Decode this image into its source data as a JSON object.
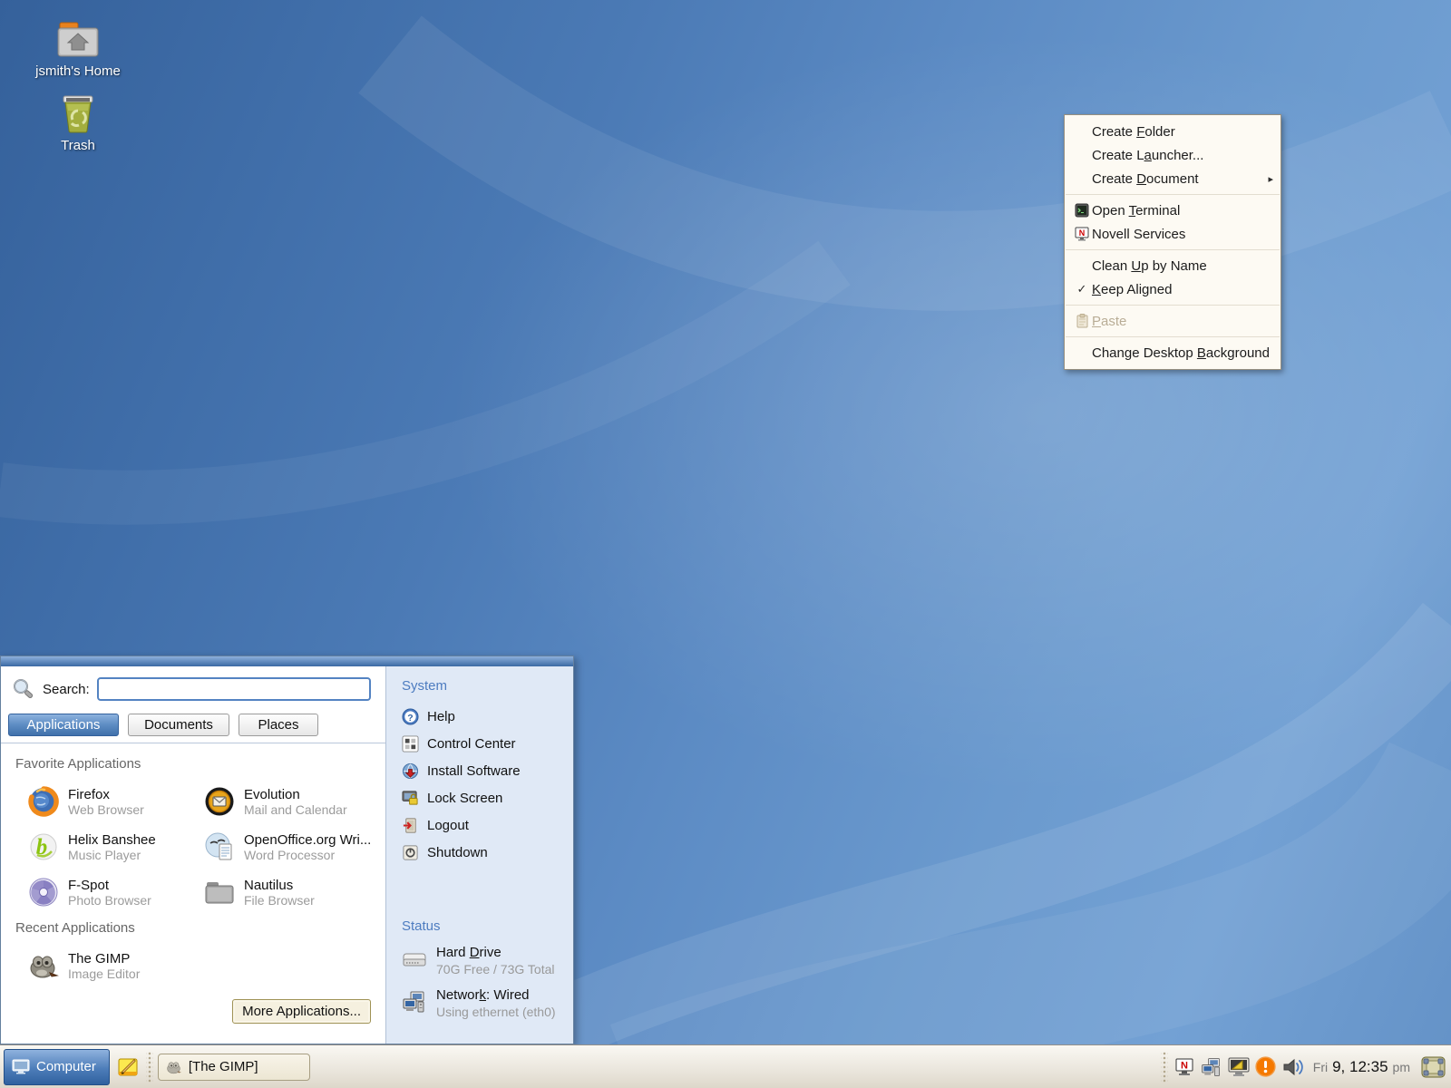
{
  "colors": {
    "accent_blue": "#4071ab",
    "menu_cream": "#fdfaf3",
    "panel_blue": "#e0e9f6",
    "taskbar_tan": "#e7e2d8",
    "selection_blue": "#5383c2",
    "update_orange": "#f57900"
  },
  "desktop": {
    "icons": [
      {
        "label": "jsmith's Home",
        "icon": "home-folder-icon"
      },
      {
        "label": "Trash",
        "icon": "trash-icon"
      }
    ]
  },
  "context_menu": {
    "items": [
      {
        "pre": "Create ",
        "key": "F",
        "post": "older"
      },
      {
        "pre": "Create L",
        "key": "a",
        "post": "uncher..."
      },
      {
        "pre": "Create ",
        "key": "D",
        "post": "ocument",
        "submenu": true
      },
      {
        "pre": "Open ",
        "key": "T",
        "post": "erminal",
        "icon": "terminal-icon"
      },
      {
        "pre": "Novell Services",
        "key": "",
        "post": "",
        "icon": "novell-icon"
      },
      {
        "pre": "Clean ",
        "key": "U",
        "post": "p by Name"
      },
      {
        "pre": "",
        "key": "K",
        "post": "eep Aligned",
        "checked": true
      },
      {
        "pre": "",
        "key": "P",
        "post": "aste",
        "icon": "paste-icon",
        "disabled": true
      },
      {
        "pre": "Change Desktop ",
        "key": "B",
        "post": "ackground"
      }
    ]
  },
  "menu": {
    "search": {
      "label": "Search:",
      "value": ""
    },
    "tabs": [
      {
        "label": "Applications",
        "active": true
      },
      {
        "label": "Documents",
        "active": false
      },
      {
        "label": "Places",
        "active": false
      }
    ],
    "favorites_header": "Favorite Applications",
    "recent_header": "Recent Applications",
    "favorites": [
      {
        "name": "Firefox",
        "desc": "Web Browser",
        "icon": "firefox-icon"
      },
      {
        "name": "Evolution",
        "desc": "Mail and Calendar",
        "icon": "evolution-icon"
      },
      {
        "name": "Helix Banshee",
        "desc": "Music Player",
        "icon": "banshee-icon"
      },
      {
        "name": "OpenOffice.org Wri...",
        "desc": "Word Processor",
        "icon": "writer-icon"
      },
      {
        "name": "F-Spot",
        "desc": "Photo Browser",
        "icon": "fspot-icon"
      },
      {
        "name": "Nautilus",
        "desc": "File Browser",
        "icon": "nautilus-icon"
      }
    ],
    "recent": [
      {
        "name": "The GIMP",
        "desc": "Image Editor",
        "icon": "gimp-icon"
      }
    ],
    "more_button": "More Applications...",
    "system_header": "System",
    "system_items": [
      {
        "label": "Help",
        "icon": "help-icon"
      },
      {
        "label": "Control Center",
        "icon": "control-center-icon"
      },
      {
        "label": "Install Software",
        "icon": "install-software-icon"
      },
      {
        "label": "Lock Screen",
        "icon": "lock-screen-icon"
      },
      {
        "label": "Logout",
        "icon": "logout-icon"
      },
      {
        "label": "Shutdown",
        "icon": "shutdown-icon"
      }
    ],
    "status_header": "Status",
    "status_items": [
      {
        "pre": "Hard ",
        "key": "D",
        "post": "rive",
        "sub": "70G Free / 73G Total",
        "icon": "hard-drive-icon"
      },
      {
        "pre": "Networ",
        "key": "k",
        "post": ": Wired",
        "sub": "Using ethernet (eth0)",
        "icon": "network-icon"
      }
    ]
  },
  "taskbar": {
    "computer_label": "Computer",
    "task_label": "[The GIMP]",
    "tray_icons": [
      "novell-tray-icon",
      "network-tray-icon",
      "display-tray-icon",
      "updates-tray-icon",
      "volume-tray-icon"
    ],
    "clock": {
      "day": "Fri",
      "time": "9, 12:35",
      "meridiem": "pm"
    }
  }
}
